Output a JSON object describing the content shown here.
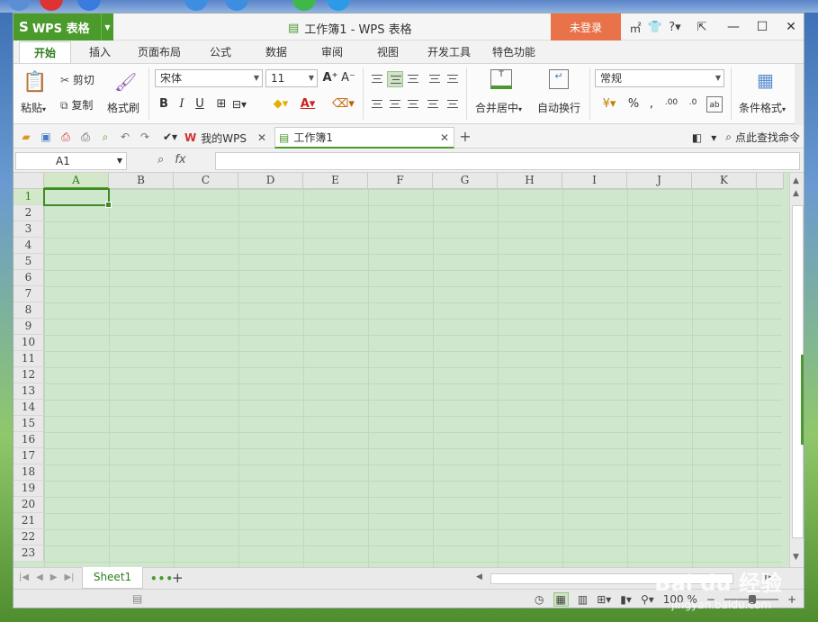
{
  "app": {
    "brand": "WPS 表格",
    "window_title": "工作簿1 - WPS 表格",
    "login_label": "未登录"
  },
  "tabs": [
    "开始",
    "插入",
    "页面布局",
    "公式",
    "数据",
    "审阅",
    "视图",
    "开发工具",
    "特色功能"
  ],
  "ribbon": {
    "paste": "粘贴",
    "cut": "剪切",
    "copy": "复制",
    "format_painter": "格式刷",
    "font_name": "宋体",
    "font_size": "11",
    "merge_center": "合并居中",
    "wrap_text": "自动换行",
    "number_format": "常规",
    "conditional_format": "条件格式",
    "bold": "B",
    "italic": "I",
    "underline": "U"
  },
  "doc_tabs": {
    "my_wps": "我的WPS",
    "workbook": "工作簿1",
    "search_command": "点此查找命令"
  },
  "formula": {
    "name_box": "A1",
    "fx": "fx",
    "value": ""
  },
  "grid": {
    "columns": [
      "A",
      "B",
      "C",
      "D",
      "E",
      "F",
      "G",
      "H",
      "I",
      "J",
      "K"
    ],
    "rows": [
      "1",
      "2",
      "3",
      "4",
      "5",
      "6",
      "7",
      "8",
      "9",
      "10",
      "11",
      "12",
      "13",
      "14",
      "15",
      "16",
      "17",
      "18",
      "19",
      "20",
      "21",
      "22",
      "23"
    ],
    "active_cell": "A1"
  },
  "sheets": {
    "tabs": [
      "Sheet1"
    ],
    "more": "•••",
    "add": "+"
  },
  "status": {
    "zoom": "100 %"
  },
  "watermark": {
    "logo": "Bai du 经验",
    "url": "jingyan.baidu.com"
  },
  "colors": {
    "accent": "#4a9a2c",
    "login": "#e8734a",
    "grid_bg": "#cfe8cd"
  }
}
